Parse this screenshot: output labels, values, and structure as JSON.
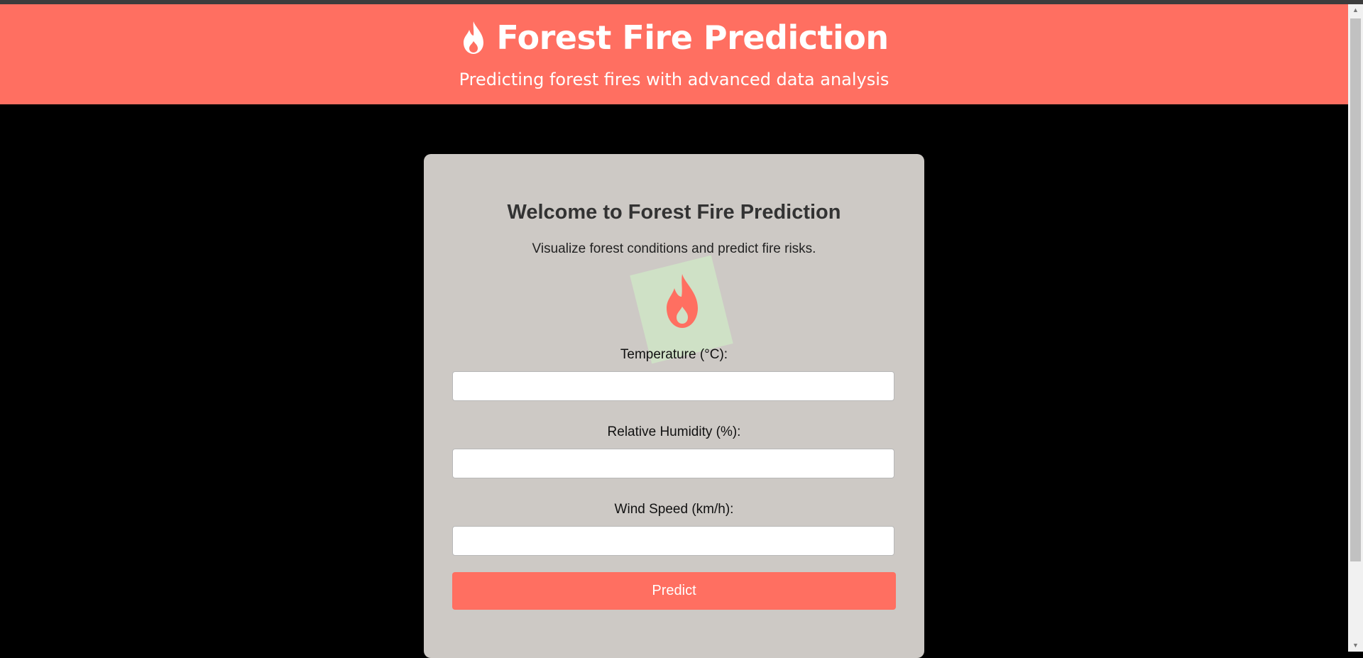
{
  "header": {
    "title": "Forest Fire Prediction",
    "subtitle": "Predicting forest fires with advanced data analysis",
    "icon": "flame-icon"
  },
  "card": {
    "title": "Welcome to Forest Fire Prediction",
    "subtitle": "Visualize forest conditions and predict fire risks.",
    "illustration_icon": "flame-icon"
  },
  "form": {
    "temperature": {
      "label": "Temperature (°C):",
      "value": "",
      "placeholder": ""
    },
    "humidity": {
      "label": "Relative Humidity (%):",
      "value": "",
      "placeholder": ""
    },
    "wind": {
      "label": "Wind Speed (km/h):",
      "value": "",
      "placeholder": ""
    },
    "submit_label": "Predict"
  },
  "colors": {
    "accent": "#ff6f61",
    "card_bg": "#cdc9c5",
    "page_bg": "#000000",
    "illustration_bg": "#cfe1c6"
  }
}
